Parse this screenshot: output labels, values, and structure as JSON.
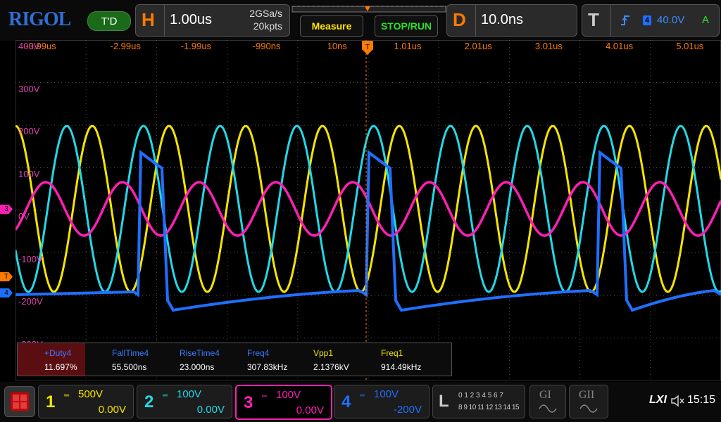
{
  "top": {
    "logo": "RIGOL",
    "trigger_status": "T'D",
    "h_letter": "H",
    "h_timebase": "1.00us",
    "sample_rate": "2GSa/s",
    "mem_depth": "20kpts",
    "measure_label": "Measure",
    "stop_run_label": "STOP/RUN",
    "d_letter": "D",
    "delay": "10.0ns",
    "t_letter": "T",
    "trigger_source": "4",
    "trigger_level": "40.0V",
    "trigger_mode": "A"
  },
  "time_ticks": [
    "-3.99us",
    "-2.99us",
    "-1.99us",
    "-990ns",
    "10ns",
    "1.01us",
    "2.01us",
    "3.01us",
    "4.01us",
    "5.01us"
  ],
  "volt_ticks": [
    "400V",
    "300V",
    "200V",
    "100V",
    "0V",
    "-100V",
    "-200V",
    "-300V"
  ],
  "side_markers": {
    "ch3": "3",
    "trig": "T",
    "ch4": "4"
  },
  "measurements": [
    {
      "label": "+Duty4",
      "value": "11.697%",
      "color": "#3a7bff"
    },
    {
      "label": "FallTime4",
      "value": "55.500ns",
      "color": "#3a7bff"
    },
    {
      "label": "RiseTime4",
      "value": "23.000ns",
      "color": "#3a7bff"
    },
    {
      "label": "Freq4",
      "value": "307.83kHz",
      "color": "#3a7bff"
    },
    {
      "label": "Vpp1",
      "value": "2.1376kV",
      "color": "#f5e400"
    },
    {
      "label": "Freq1",
      "value": "914.49kHz",
      "color": "#f5e400"
    }
  ],
  "channels": [
    {
      "num": "1",
      "scale": "500V",
      "offset": "0.00V",
      "color": "#f5e400"
    },
    {
      "num": "2",
      "scale": "100V",
      "offset": "0.00V",
      "color": "#22d8e8"
    },
    {
      "num": "3",
      "scale": "100V",
      "offset": "0.00V",
      "color": "#ff1fb4"
    },
    {
      "num": "4",
      "scale": "100V",
      "offset": "-200V",
      "color": "#1f6fff"
    }
  ],
  "logic": {
    "letter": "L",
    "row1": "0 1 2 3  4 5 6 7",
    "row2": "8 9 10 11 12 13 14 15"
  },
  "gen1": "GI",
  "gen2": "GII",
  "status": {
    "lxi": "LXI",
    "time": "15:15"
  },
  "colors": {
    "ch1": "#f5e400",
    "ch2": "#22d8e8",
    "ch3": "#ff1fb4",
    "ch4": "#1f6fff",
    "accent": "#ff7a00"
  }
}
